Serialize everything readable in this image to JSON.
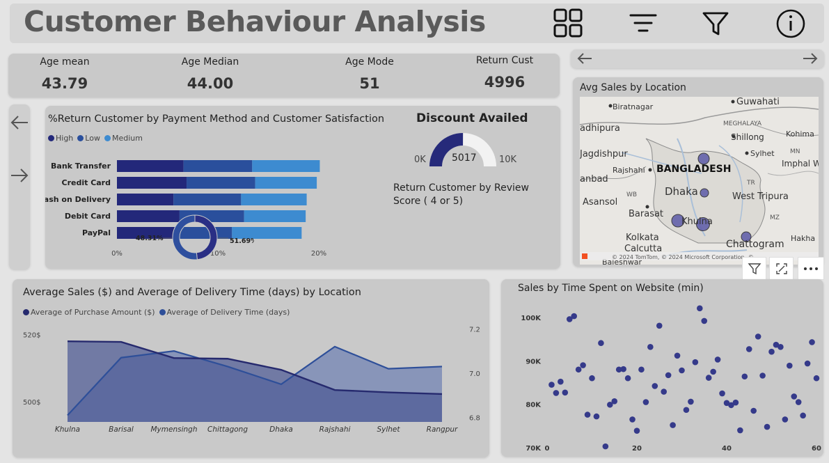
{
  "header": {
    "title": "Customer Behaviour Analysis",
    "icons": [
      "grid-icon",
      "sort-lines-icon",
      "filter-icon",
      "info-icon"
    ]
  },
  "kpis": [
    {
      "label": "Age mean",
      "value": "43.79"
    },
    {
      "label": "Age Median",
      "value": "44.00"
    },
    {
      "label": "Age Mode",
      "value": "51"
    },
    {
      "label": "Return Cust",
      "value": "4996"
    }
  ],
  "return_chart": {
    "title": "%Return Customer by Payment Method and Customer Satisfaction",
    "legend": [
      "High",
      "Low",
      "Medium"
    ],
    "colors": [
      "#23287a",
      "#2a4f9c",
      "#3d8bd0"
    ],
    "x_ticks": [
      "0%",
      "10%",
      "20%"
    ]
  },
  "discount": {
    "title": "Discount Availed",
    "value": "5017",
    "min_label": "0K",
    "max_label": "10K",
    "fill_fraction": 0.5017
  },
  "review": {
    "title": "Return Customer by Review Score ( 4 or 5)",
    "legend": [
      "4.0",
      "5.0"
    ],
    "labels": [
      "48.31%",
      "51.69%"
    ]
  },
  "map": {
    "title": "Avg Sales by Location",
    "places": [
      "Guwahati",
      "Biratnagar",
      "MEGHALAYA",
      "Shillong",
      "Kohima",
      "adhipura",
      "Jagdishpur",
      "Sylhet",
      "MN",
      "Imphal W",
      "Rajshahi",
      "BANGLADESH",
      "anbad",
      "WB",
      "Dhaka",
      "TR",
      "West Tripura",
      "Asansol",
      "Barasat",
      "Khulna",
      "MZ",
      "Kolkata",
      "Calcutta",
      "Chattogram",
      "Hakha",
      "Baleshwar"
    ],
    "attribution": "© 2024 TomTom, © 2024 Microsoft Corporation, ©"
  },
  "sales_delivery": {
    "title": "Average Sales ($) and Average of Delivery Time (days) by Location",
    "legend": [
      "Average of Purchase Amount ($)",
      "Average of Delivery Time (days)"
    ]
  },
  "scatter": {
    "title": "Sales by Time Spent on Website (min)"
  },
  "chart_data": [
    {
      "type": "bar",
      "stacked": true,
      "orientation": "horizontal",
      "title": "%Return Customer by Payment Method and Customer Satisfaction",
      "categories": [
        "Bank Transfer",
        "Credit Card",
        "Cash on Delivery",
        "Debit Card",
        "PayPal"
      ],
      "series": [
        {
          "name": "High",
          "values": [
            6.6,
            6.9,
            5.6,
            6.2,
            5.7
          ]
        },
        {
          "name": "Low",
          "values": [
            6.8,
            6.8,
            6.7,
            6.4,
            5.7
          ]
        },
        {
          "name": "Medium",
          "values": [
            6.7,
            6.1,
            6.5,
            6.1,
            6.9
          ]
        }
      ],
      "xlim": [
        0,
        20
      ],
      "legend_position": "top-left"
    },
    {
      "type": "pie",
      "donut": true,
      "title": "Return Customer by Review Score ( 4 or 5)",
      "categories": [
        "4.0",
        "5.0"
      ],
      "values": [
        48.31,
        51.69
      ]
    },
    {
      "type": "area",
      "title": "Average Sales ($) and Average of Delivery Time (days) by Location",
      "categories": [
        "Khulna",
        "Barisal",
        "Mymensingh",
        "Chittagong",
        "Dhaka",
        "Rajshahi",
        "Sylhet",
        "Rangpur"
      ],
      "series": [
        {
          "name": "Average of Purchase Amount ($)",
          "axis": "left",
          "values": [
            518,
            517.8,
            513,
            512.8,
            509.5,
            503.5,
            502.8,
            502.3
          ]
        },
        {
          "name": "Average of Delivery Time (days)",
          "axis": "right",
          "values": [
            6.81,
            7.07,
            7.1,
            7.03,
            6.95,
            7.12,
            7.02,
            7.03
          ]
        }
      ],
      "y_left_ticks": [
        "520$",
        "500$"
      ],
      "y_left_tick_values": [
        520,
        500
      ],
      "y_left_range": [
        494,
        523
      ],
      "y_right_ticks": [
        "7.2",
        "7.0",
        "6.8"
      ],
      "y_right_tick_values": [
        7.2,
        7.0,
        6.8
      ],
      "y_right_range": [
        6.78,
        7.22
      ],
      "legend_position": "top-left"
    },
    {
      "type": "scatter",
      "title": "Sales by Time Spent on Website (min)",
      "x_ticks": [
        "0",
        "20",
        "40",
        "60"
      ],
      "x_tick_values": [
        0,
        20,
        40,
        60
      ],
      "y_ticks": [
        "100K",
        "90K",
        "80K",
        "70K"
      ],
      "y_tick_values": [
        100000,
        90000,
        80000,
        70000
      ],
      "xlim": [
        0,
        60
      ],
      "ylim": [
        70000,
        104000
      ],
      "points": [
        [
          1,
          84500
        ],
        [
          2,
          82600
        ],
        [
          3,
          85200
        ],
        [
          4,
          82700
        ],
        [
          5,
          99600
        ],
        [
          6,
          100300
        ],
        [
          7,
          88000
        ],
        [
          8,
          89000
        ],
        [
          9,
          77600
        ],
        [
          10,
          86000
        ],
        [
          11,
          77200
        ],
        [
          12,
          94100
        ],
        [
          13,
          70300
        ],
        [
          14,
          79900
        ],
        [
          15,
          80700
        ],
        [
          16,
          88000
        ],
        [
          17,
          88100
        ],
        [
          18,
          86000
        ],
        [
          19,
          76500
        ],
        [
          20,
          73900
        ],
        [
          21,
          88000
        ],
        [
          22,
          80500
        ],
        [
          23,
          93200
        ],
        [
          24,
          84200
        ],
        [
          25,
          98100
        ],
        [
          26,
          82900
        ],
        [
          27,
          86700
        ],
        [
          28,
          75200
        ],
        [
          29,
          91200
        ],
        [
          30,
          87800
        ],
        [
          31,
          78700
        ],
        [
          32,
          80600
        ],
        [
          33,
          89700
        ],
        [
          34,
          102100
        ],
        [
          35,
          99200
        ],
        [
          36,
          86100
        ],
        [
          37,
          87500
        ],
        [
          38,
          90300
        ],
        [
          39,
          82500
        ],
        [
          40,
          80300
        ],
        [
          41,
          79800
        ],
        [
          42,
          80400
        ],
        [
          43,
          74000
        ],
        [
          44,
          86400
        ],
        [
          45,
          92700
        ],
        [
          46,
          78500
        ],
        [
          47,
          95600
        ],
        [
          48,
          86600
        ],
        [
          49,
          74800
        ],
        [
          50,
          92100
        ],
        [
          51,
          93700
        ],
        [
          52,
          93200
        ],
        [
          53,
          76500
        ],
        [
          54,
          88900
        ],
        [
          55,
          81800
        ],
        [
          56,
          80500
        ],
        [
          57,
          77400
        ],
        [
          58,
          89400
        ],
        [
          59,
          94300
        ],
        [
          60,
          86000
        ]
      ]
    }
  ]
}
